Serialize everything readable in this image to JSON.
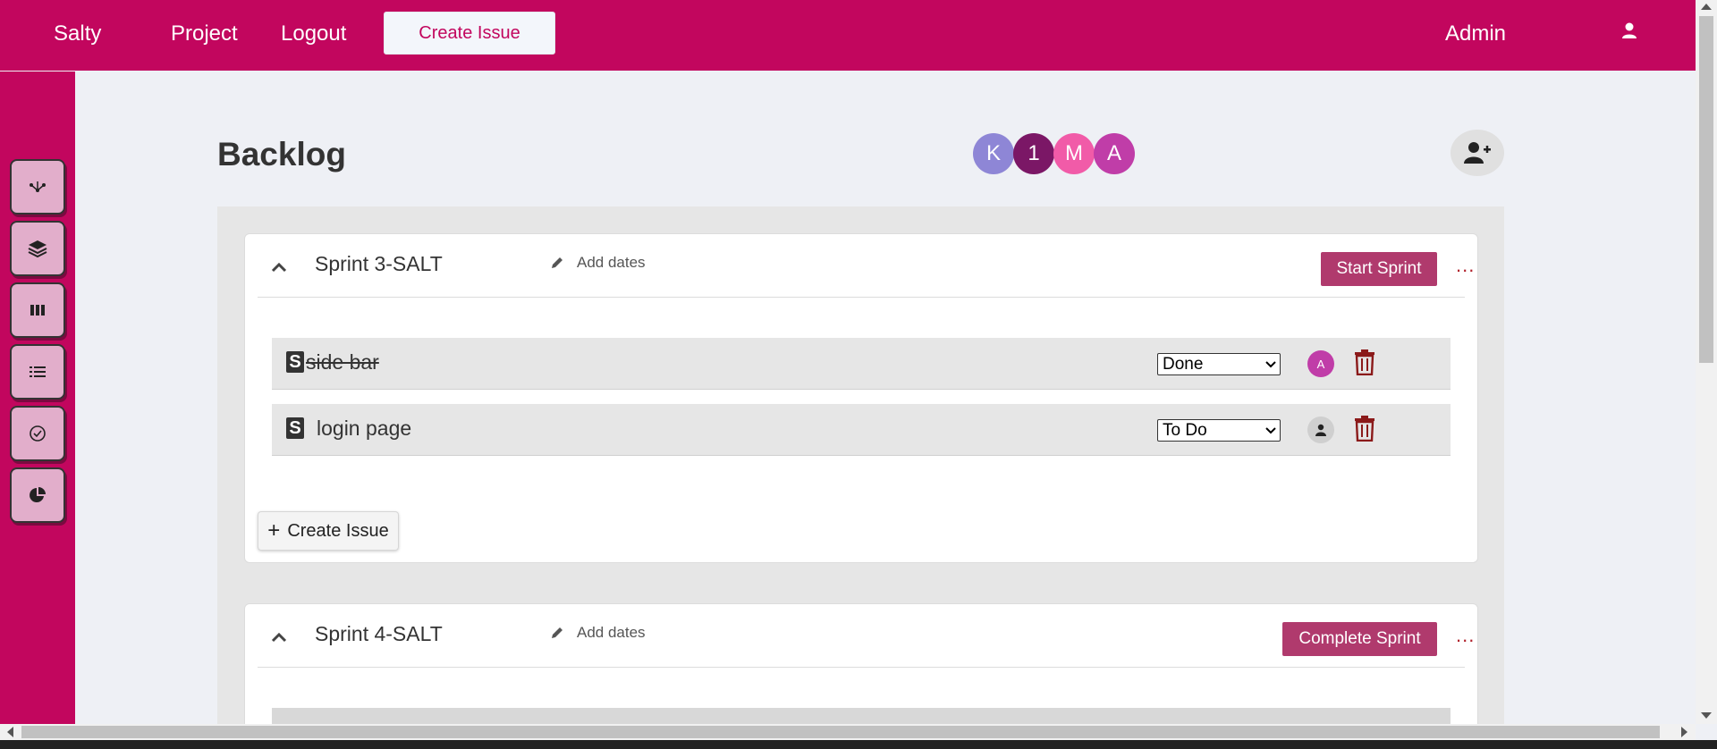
{
  "nav": {
    "brand": "Salty",
    "project": "Project",
    "logout": "Logout",
    "create_issue": "Create Issue",
    "user_name": "Admin"
  },
  "sidebar": {
    "items": [
      {
        "icon": "roadmap-icon"
      },
      {
        "icon": "layers-icon"
      },
      {
        "icon": "board-columns-icon"
      },
      {
        "icon": "list-icon"
      },
      {
        "icon": "check-circle-icon"
      },
      {
        "icon": "pie-chart-icon"
      }
    ]
  },
  "header": {
    "title": "Backlog",
    "members": [
      {
        "initial": "K",
        "color": "#8e86d6"
      },
      {
        "initial": "1",
        "color": "#7b1766"
      },
      {
        "initial": "M",
        "color": "#f15ba8"
      },
      {
        "initial": "A",
        "color": "#c03da8"
      }
    ]
  },
  "sprints": [
    {
      "name": "Sprint 3-SALT",
      "add_dates": "Add dates",
      "action": "Start Sprint",
      "more": "...",
      "issues": [
        {
          "type": "S",
          "title": "side bar",
          "status": "Done",
          "assignee": "A"
        },
        {
          "type": "S",
          "title": "login page",
          "status": "To Do",
          "assignee": ""
        }
      ],
      "create_issue": "Create Issue"
    },
    {
      "name": "Sprint 4-SALT",
      "add_dates": "Add dates",
      "action": "Complete Sprint",
      "more": "..."
    }
  ],
  "colors": {
    "brand": "#c2065e",
    "sidebar_button": "#e2aecb",
    "sprint_button": "#b03a6d",
    "danger": "#8b1a1a"
  }
}
